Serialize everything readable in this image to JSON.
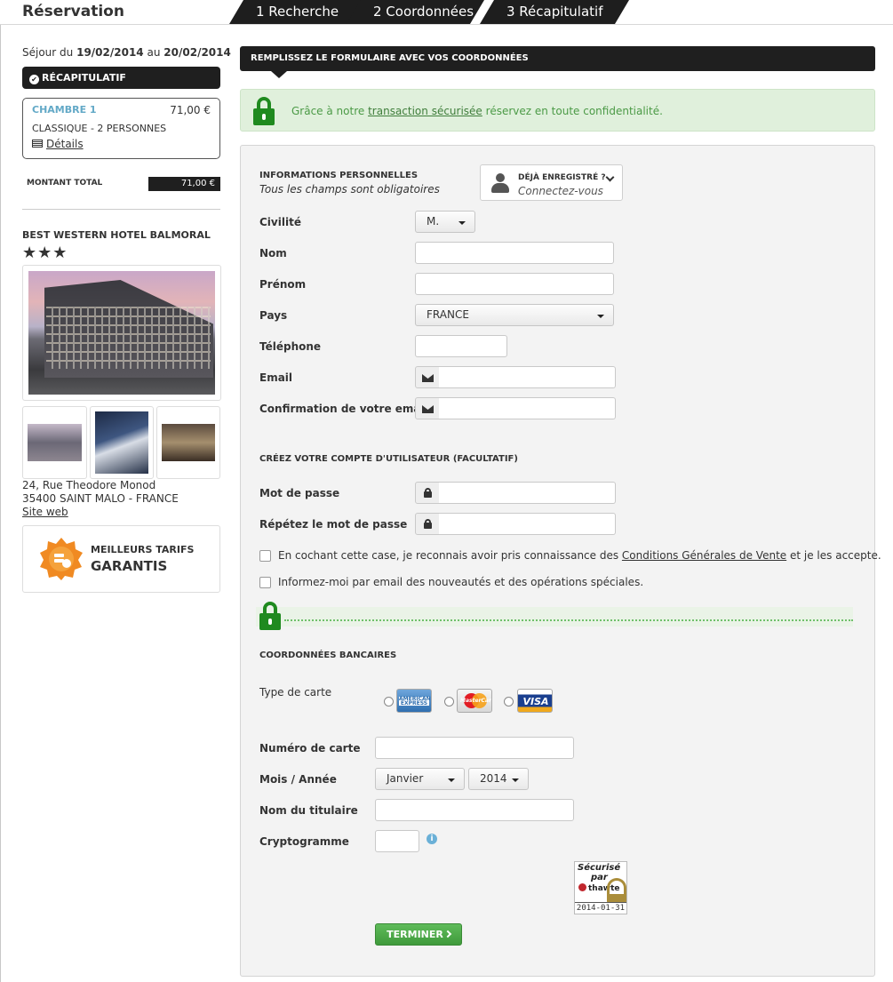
{
  "header": {
    "title": "Réservation",
    "steps": [
      {
        "label": "1 Recherche"
      },
      {
        "label": "2 Coordonnées"
      },
      {
        "label": "3 Récapitulatif"
      }
    ]
  },
  "sidebar": {
    "stay_prefix": "Séjour du",
    "date_from": "19/02/2014",
    "stay_mid": "au",
    "date_to": "20/02/2014",
    "recap_label": "RÉCAPITULATIF",
    "room": {
      "name": "CHAMBRE 1",
      "price": "71,00 €",
      "type": "CLASSIQUE - 2 PERSONNES",
      "details_link": "Détails"
    },
    "total_label": "MONTANT TOTAL",
    "total_value": "71,00 €",
    "hotel_name": "BEST WESTERN HOTEL BALMORAL",
    "stars": "★★★",
    "address_line1": "24, Rue Theodore Monod",
    "address_line2": "35400 SAINT MALO - FRANCE",
    "website_link": "Site web",
    "best_rates_line1": "MEILLEURS TARIFS",
    "best_rates_line2": "GARANTIS"
  },
  "form": {
    "header": "REMPLISSEZ LE FORMULAIRE AVEC VOS COORDONNÉES",
    "secure_text_before": "Grâce à notre",
    "secure_link": "transaction sécurisée",
    "secure_text_after": "réservez en toute confidentialité.",
    "personal": {
      "title": "INFORMATIONS PERSONNELLES",
      "note": "Tous les champs sont obligatoires",
      "registered_title": "DÉJÀ ENREGISTRÉ ?",
      "registered_link": "Connectez-vous",
      "civility_label": "Civilité",
      "civility_value": "M.",
      "lastname_label": "Nom",
      "firstname_label": "Prénom",
      "country_label": "Pays",
      "country_value": "FRANCE",
      "phone_label": "Téléphone",
      "email_label": "Email",
      "email_confirm_label": "Confirmation de votre email"
    },
    "account": {
      "title": "CRÉEZ VOTRE COMPTE D'UTILISATEUR (FACULTATIF)",
      "password_label": "Mot de passe",
      "password_repeat_label": "Répétez le mot de passe",
      "cgv_before": "En cochant cette case, je reconnais avoir pris connaissance des",
      "cgv_link": "Conditions Générales de Vente",
      "cgv_after": "et je les accepte.",
      "newsletter": "Informez-moi par email des nouveautés et des opérations spéciales."
    },
    "bank": {
      "title": "COORDONNÉES BANCAIRES",
      "card_type_label": "Type de carte",
      "cards": [
        {
          "name": "amex",
          "label": "AMERICAN EXPRESS"
        },
        {
          "name": "mastercard",
          "label": "MasterCard"
        },
        {
          "name": "visa",
          "label": "VISA"
        }
      ],
      "card_number_label": "Numéro de carte",
      "month_year_label": "Mois / Année",
      "month_value": "Janvier",
      "year_value": "2014",
      "holder_label": "Nom du titulaire",
      "cvv_label": "Cryptogramme",
      "thawte_line1": "Sécurisé",
      "thawte_line2": "par",
      "thawte_line3": "thawte",
      "thawte_date": "2014-01-31",
      "submit_label": "TERMINER"
    }
  }
}
